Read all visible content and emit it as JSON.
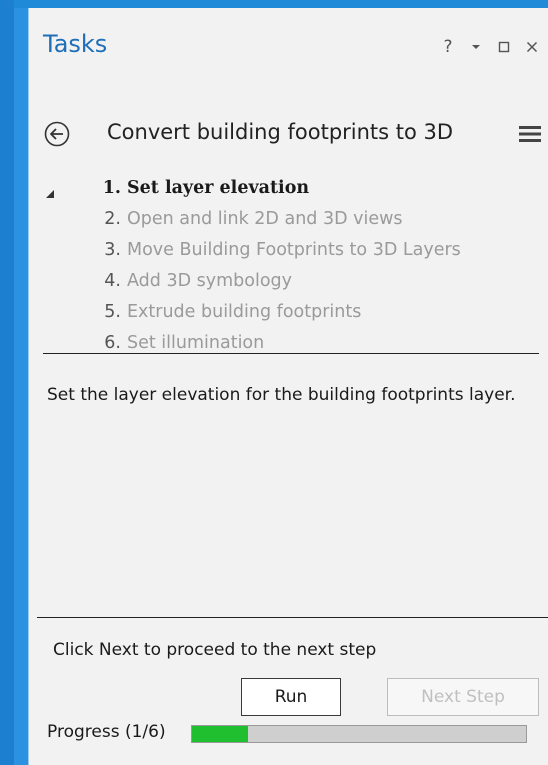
{
  "pane": {
    "title": "Tasks",
    "controls": {
      "help": "?"
    }
  },
  "task": {
    "title": "Convert building footprints to 3D",
    "back_icon": "back-arrow-icon",
    "menu_icon": "hamburger-menu-icon"
  },
  "steps": [
    {
      "num": "1.",
      "label": "Set layer elevation",
      "active": true
    },
    {
      "num": "2.",
      "label": "Open and link 2D and 3D views",
      "active": false
    },
    {
      "num": "3.",
      "label": "Move Building Footprints to 3D Layers",
      "active": false
    },
    {
      "num": "4.",
      "label": "Add 3D symbology",
      "active": false
    },
    {
      "num": "5.",
      "label": "Extrude building footprints",
      "active": false
    },
    {
      "num": "6.",
      "label": "Set illumination",
      "active": false
    }
  ],
  "description": "Set the layer elevation for the building footprints layer.",
  "hint": "Click Next to proceed to the next step",
  "buttons": {
    "run": "Run",
    "next": "Next Step"
  },
  "progress": {
    "label": "Progress (1/6)",
    "fraction": 0.1667
  },
  "colors": {
    "accent": "#1e6fb8",
    "progress_fill": "#1fbf2f",
    "window_blue": "#1f8ad8"
  }
}
